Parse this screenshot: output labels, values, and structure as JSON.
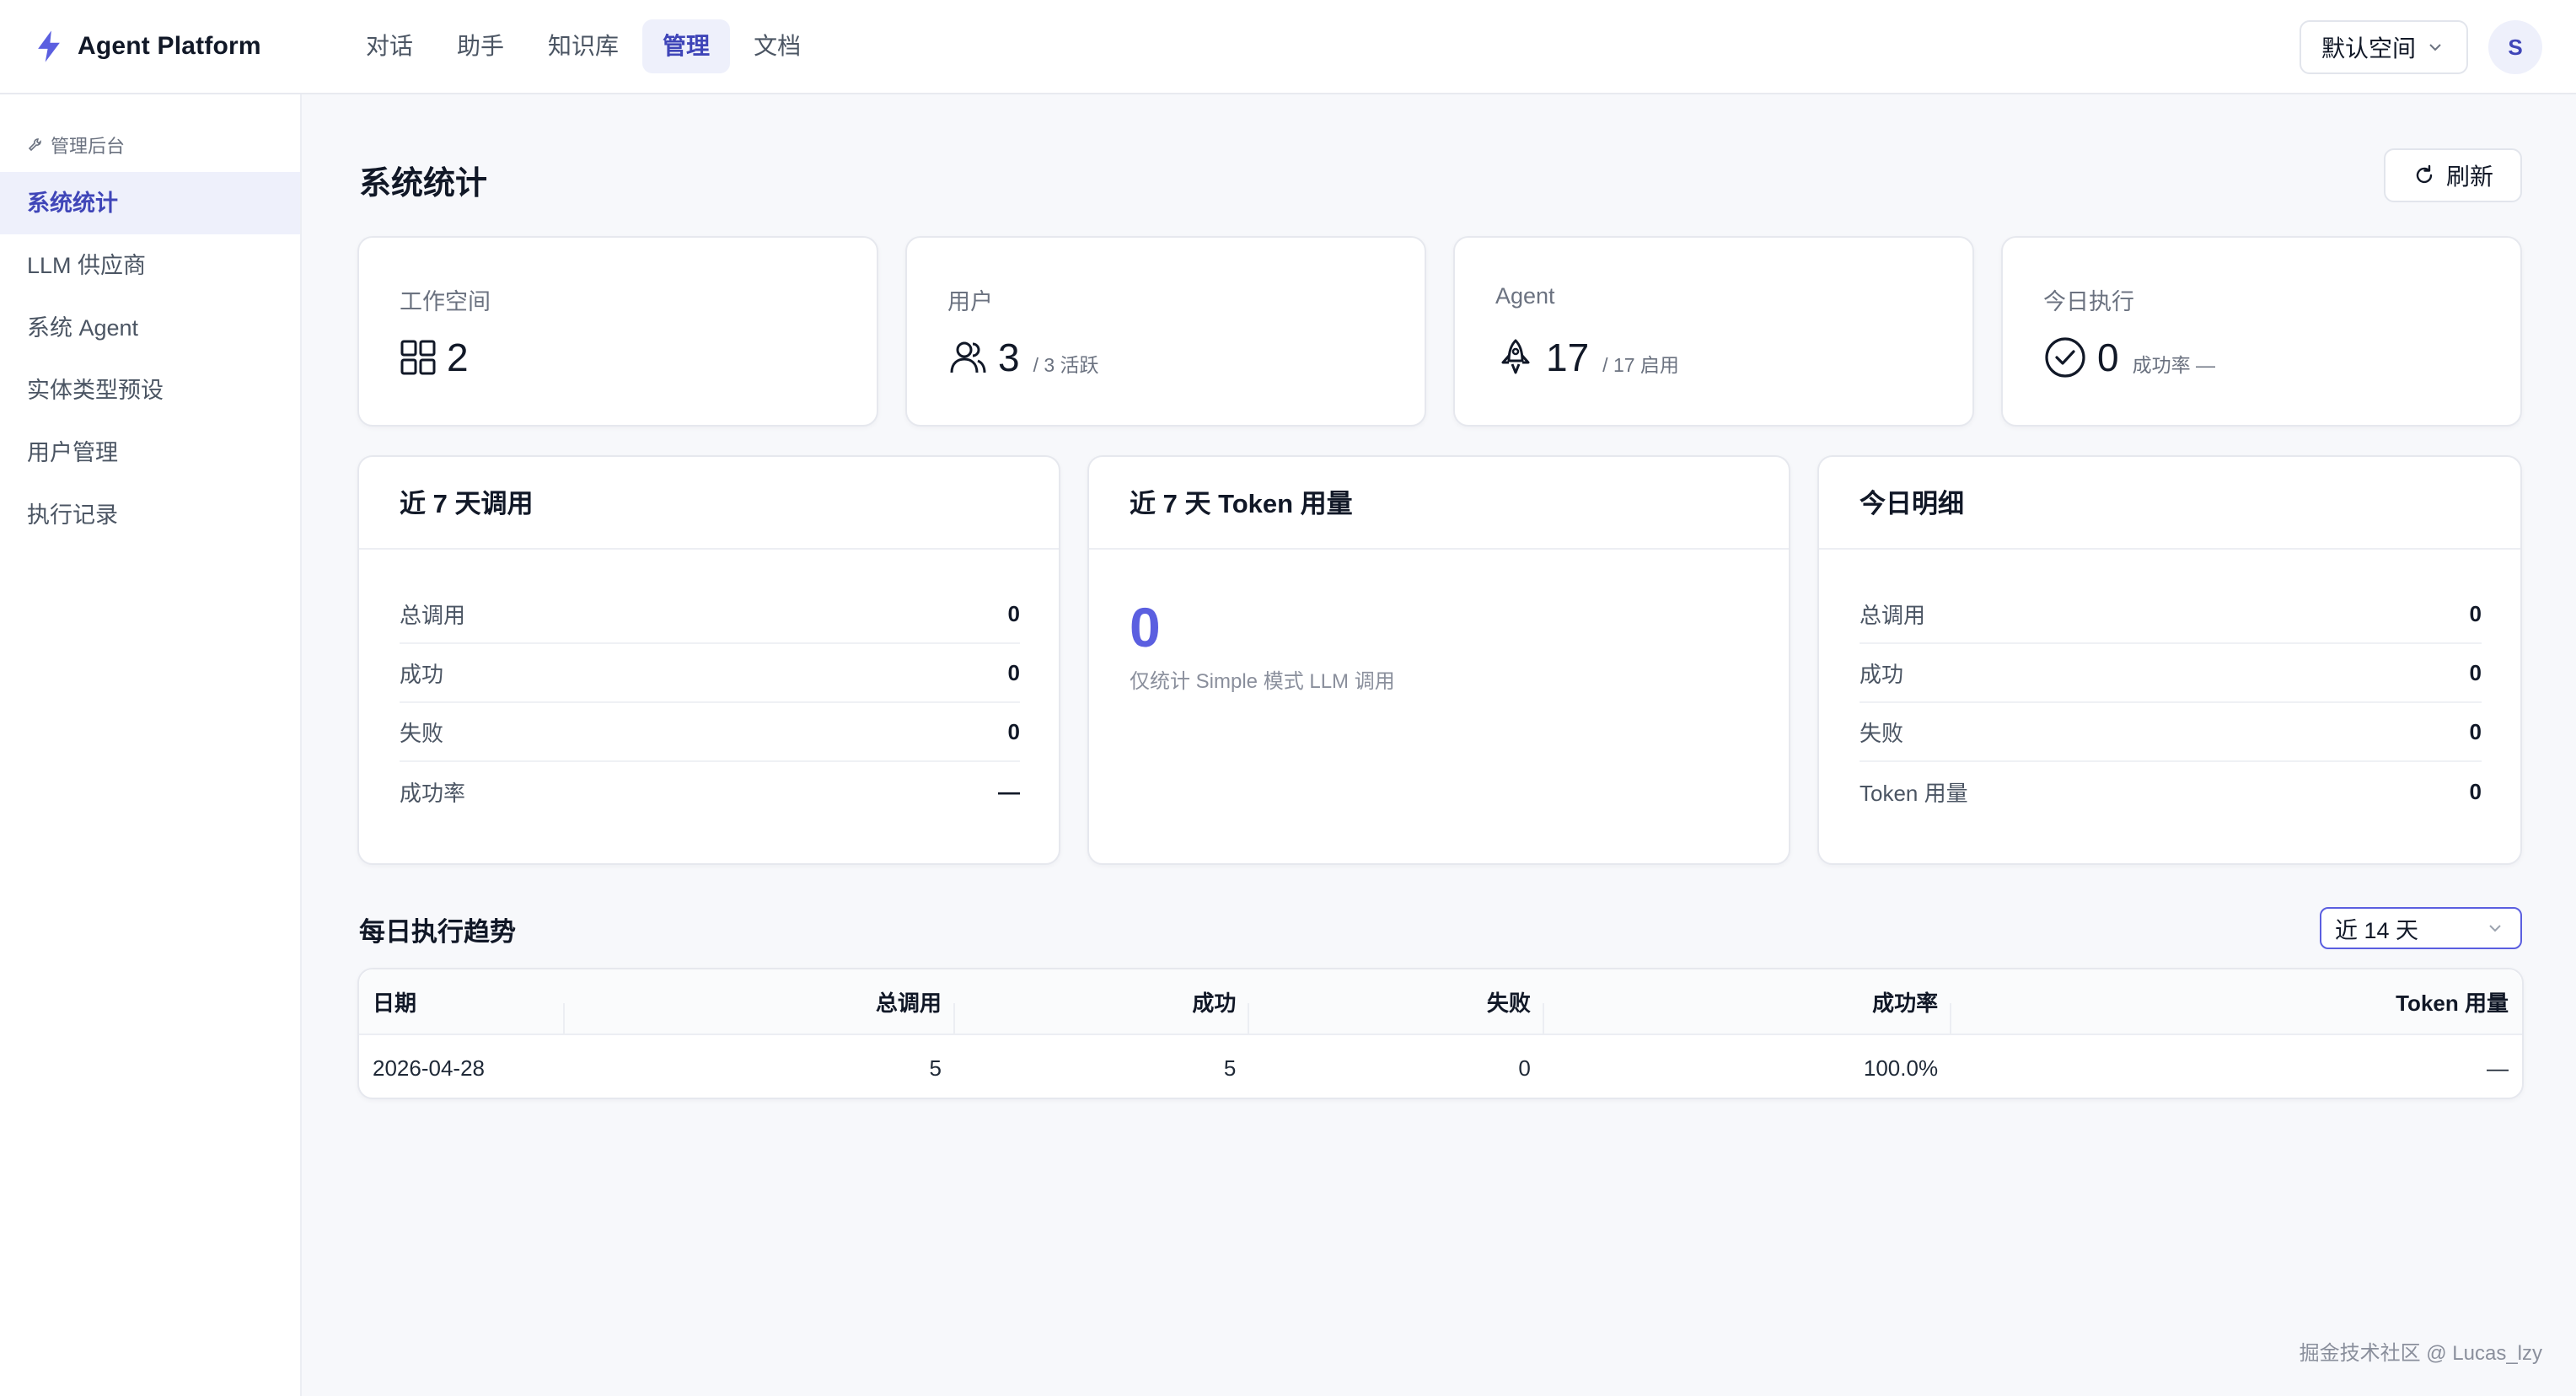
{
  "app": {
    "name": "Agent Platform",
    "logo_icon": "lightning-icon",
    "accent": "#5b5fe0"
  },
  "nav": {
    "items": [
      {
        "label": "对话"
      },
      {
        "label": "助手"
      },
      {
        "label": "知识库"
      },
      {
        "label": "管理",
        "active": true
      },
      {
        "label": "文档"
      }
    ]
  },
  "topbar": {
    "workspace": "默认空间",
    "avatar": "S"
  },
  "sidebar": {
    "section": "管理后台",
    "items": [
      {
        "label": "系统统计",
        "active": true
      },
      {
        "label": "LLM 供应商"
      },
      {
        "label": "系统 Agent"
      },
      {
        "label": "实体类型预设"
      },
      {
        "label": "用户管理"
      },
      {
        "label": "执行记录"
      }
    ]
  },
  "page": {
    "title": "系统统计",
    "refresh": "刷新"
  },
  "stats": [
    {
      "label": "工作空间",
      "value": "2",
      "sub": "",
      "icon": "grid-icon"
    },
    {
      "label": "用户",
      "value": "3",
      "sub": "/ 3 活跃",
      "icon": "users-icon"
    },
    {
      "label": "Agent",
      "value": "17",
      "sub": "/ 17 启用",
      "icon": "rocket-icon"
    },
    {
      "label": "今日执行",
      "value": "0",
      "sub": "成功率 —",
      "icon": "check-circle-icon"
    }
  ],
  "panel_7d": {
    "title": "近 7 天调用",
    "rows": [
      {
        "k": "总调用",
        "v": "0"
      },
      {
        "k": "成功",
        "v": "0"
      },
      {
        "k": "失败",
        "v": "0"
      },
      {
        "k": "成功率",
        "v": "—"
      }
    ]
  },
  "panel_token": {
    "title": "近 7 天 Token 用量",
    "value": "0",
    "note": "仅统计 Simple 模式 LLM 调用"
  },
  "panel_today": {
    "title": "今日明细",
    "rows": [
      {
        "k": "总调用",
        "v": "0"
      },
      {
        "k": "成功",
        "v": "0"
      },
      {
        "k": "失败",
        "v": "0"
      },
      {
        "k": "Token 用量",
        "v": "0"
      }
    ]
  },
  "trend": {
    "title": "每日执行趋势",
    "range": "近 14 天",
    "columns": [
      "日期",
      "总调用",
      "成功",
      "失败",
      "成功率",
      "Token 用量"
    ],
    "rows": [
      [
        "2026-04-28",
        "5",
        "5",
        "0",
        "100.0%",
        "—"
      ]
    ]
  },
  "watermark": "掘金技术社区 @ Lucas_lzy"
}
